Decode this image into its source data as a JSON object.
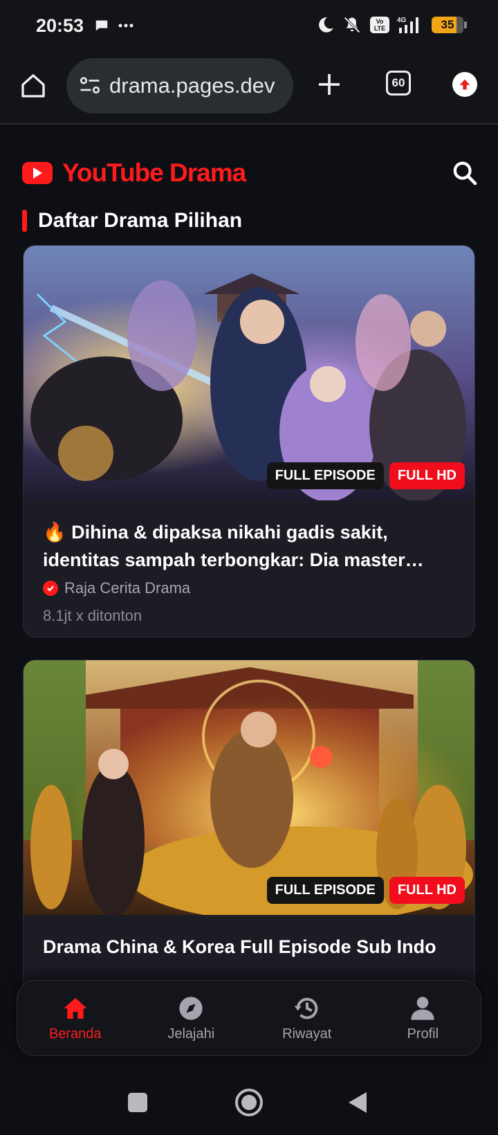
{
  "status": {
    "time": "20:53",
    "battery": "35"
  },
  "browser": {
    "url": "drama.pages.dev",
    "tab_count": "60"
  },
  "app": {
    "brand": "YouTube Drama",
    "section_title": "Daftar Drama Pilihan"
  },
  "cards": [
    {
      "title": "🔥 Dihina & dipaksa nikahi gadis sakit, identitas sampah terbongkar: Dia master…",
      "channel": "Raja Cerita Drama",
      "views": "8.1jt x ditonton",
      "badge_episode": "FULL EPISODE",
      "badge_quality": "FULL HD"
    },
    {
      "title": "Drama China & Korea Full Episode Sub Indo",
      "badge_episode": "FULL EPISODE",
      "badge_quality": "FULL HD"
    }
  ],
  "nav": {
    "items": [
      {
        "label": "Beranda",
        "icon": "home-icon",
        "active": true
      },
      {
        "label": "Jelajahi",
        "icon": "compass-icon"
      },
      {
        "label": "Riwayat",
        "icon": "history-icon"
      },
      {
        "label": "Profil",
        "icon": "user-icon"
      }
    ]
  },
  "colors": {
    "accent": "#ff1b1b",
    "background": "#0e0f14",
    "card": "#1b1c24"
  }
}
